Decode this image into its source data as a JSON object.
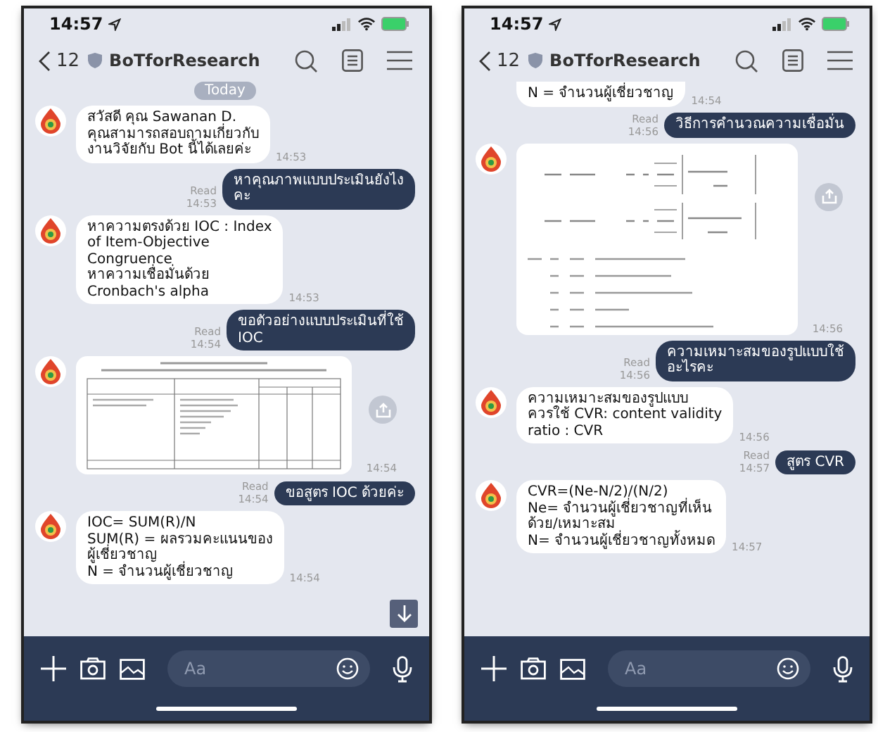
{
  "phones": [
    {
      "status_time": "14:57",
      "back_count": "12",
      "chat_title": "BoTforResearch",
      "input_placeholder": "Aa",
      "scroll_down_button": true,
      "messages": [
        {
          "kind": "date",
          "text": "Today"
        },
        {
          "kind": "incoming",
          "text": "สวัสดี คุณ Sawanan D.\nคุณสามารถสอบถามเกี่ยวกับ\nงานวิจัยกับ Bot นี้ได้เลยค่ะ",
          "time": "14:53"
        },
        {
          "kind": "outgoing",
          "text": "หาคุณภาพแบบประเมินยังไง\nคะ",
          "read": "Read",
          "time": "14:53"
        },
        {
          "kind": "incoming",
          "text": "หาความตรงด้วย IOC : Index\nof Item-Objective\nCongruence\nหาความเชื่อมั่นด้วย\nCronbach's alpha",
          "time": "14:53"
        },
        {
          "kind": "outgoing",
          "text": "ขอตัวอย่างแบบประเมินที่ใช้\nIOC",
          "read": "Read",
          "time": "14:54"
        },
        {
          "kind": "table_image",
          "time": "14:54"
        },
        {
          "kind": "outgoing",
          "text": "ขอสูตร IOC ด้วยค่ะ",
          "read": "Read",
          "time": "14:54"
        },
        {
          "kind": "incoming",
          "text": "IOC= SUM(R)/N\nSUM(R) = ผลรวมคะแนนของ\nผู้เชี่ยวชาญ\nN = จำนวนผู้เชี่ยวชาญ",
          "time": "14:54"
        }
      ]
    },
    {
      "status_time": "14:57",
      "back_count": "12",
      "chat_title": "BoTforResearch",
      "input_placeholder": "Aa",
      "scroll_down_button": false,
      "messages": [
        {
          "kind": "incoming",
          "cut_off": true,
          "text": "N = จำนวนผู้เชี่ยวชาญ",
          "time": "14:54"
        },
        {
          "kind": "outgoing",
          "text": "วิธีการคำนวณความเชื่อมั่น",
          "read": "Read",
          "time": "14:56"
        },
        {
          "kind": "formula_image",
          "time": "14:56"
        },
        {
          "kind": "outgoing",
          "text": "ความเหมาะสมของรูปแบบใช้\nอะไรคะ",
          "read": "Read",
          "time": "14:56"
        },
        {
          "kind": "incoming",
          "text": "ความเหมาะสมของรูปแบบ\nควรใช้ CVR: content validity\nratio : CVR",
          "time": "14:56"
        },
        {
          "kind": "outgoing",
          "text": "สูตร CVR",
          "read": "Read",
          "time": "14:57"
        },
        {
          "kind": "incoming",
          "text": "CVR=(Ne-N/2)/(N/2)\nNe= จำนวนผู้เชี่ยวชาญที่เห็น\nด้วย/เหมาะสม\nN= จำนวนผู้เชี่ยวชาญทั้งหมด",
          "time": "14:57"
        }
      ]
    }
  ]
}
